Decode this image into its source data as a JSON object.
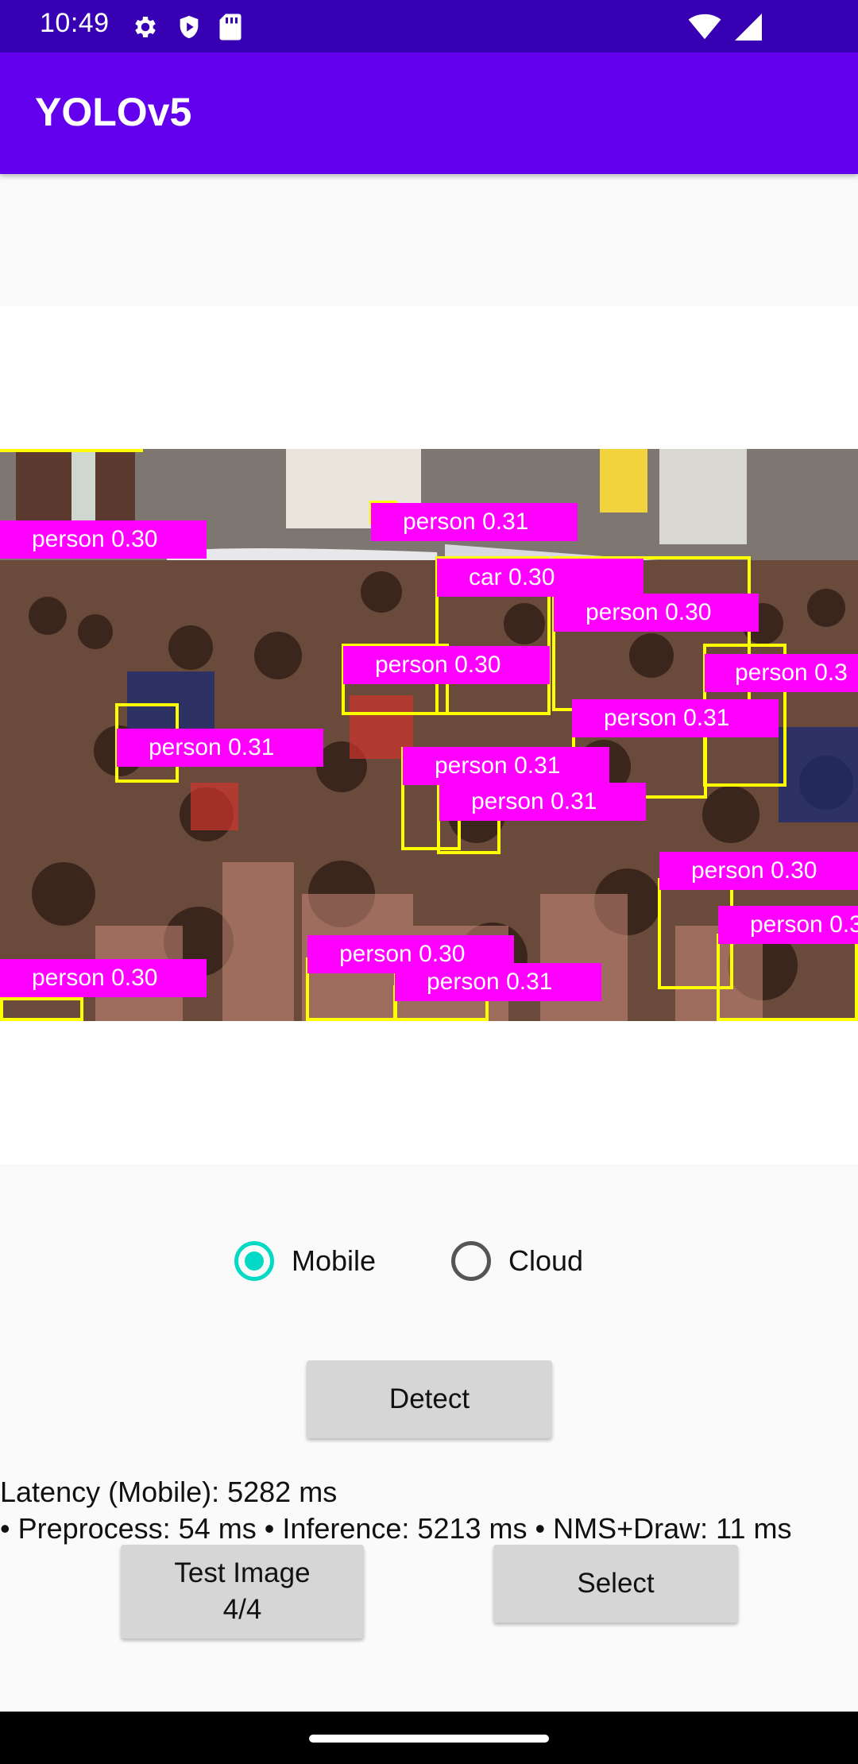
{
  "status_bar": {
    "time": "10:49",
    "icons_left": [
      "gear-icon",
      "shield-icon",
      "sd-card-icon"
    ],
    "icons_right": [
      "wifi-icon",
      "signal-icon"
    ]
  },
  "app_bar": {
    "title": "YOLOv5"
  },
  "detections": [
    {
      "label": "person 0.30"
    },
    {
      "label": "person 0.31"
    },
    {
      "label": "car 0.30"
    },
    {
      "label": "person 0.30"
    },
    {
      "label": "person 0.30"
    },
    {
      "label": "person 0.3"
    },
    {
      "label": "person 0.31"
    },
    {
      "label": "person 0.31"
    },
    {
      "label": "person 0.31"
    },
    {
      "label": "person 0.31"
    },
    {
      "label": "person 0.30"
    },
    {
      "label": "person 0.3"
    },
    {
      "label": "person 0.30"
    },
    {
      "label": "person 0.31"
    },
    {
      "label": "person 0.30"
    }
  ],
  "mode": {
    "options": [
      {
        "label": "Mobile",
        "checked": true
      },
      {
        "label": "Cloud",
        "checked": false
      }
    ]
  },
  "buttons": {
    "detect": "Detect",
    "test_image_line1": "Test Image",
    "test_image_line2": "4/4",
    "select": "Select"
  },
  "latency": {
    "line1": "Latency (Mobile): 5282 ms",
    "line2": "• Preprocess: 54 ms  • Inference: 5213 ms  • NMS+Draw: 11 ms"
  },
  "colors": {
    "status_bar": "#3700b3",
    "app_bar": "#6200ee",
    "radio_accent": "#03dac5",
    "box_border": "#ffff00",
    "box_label_bg": "#ff00ff"
  }
}
